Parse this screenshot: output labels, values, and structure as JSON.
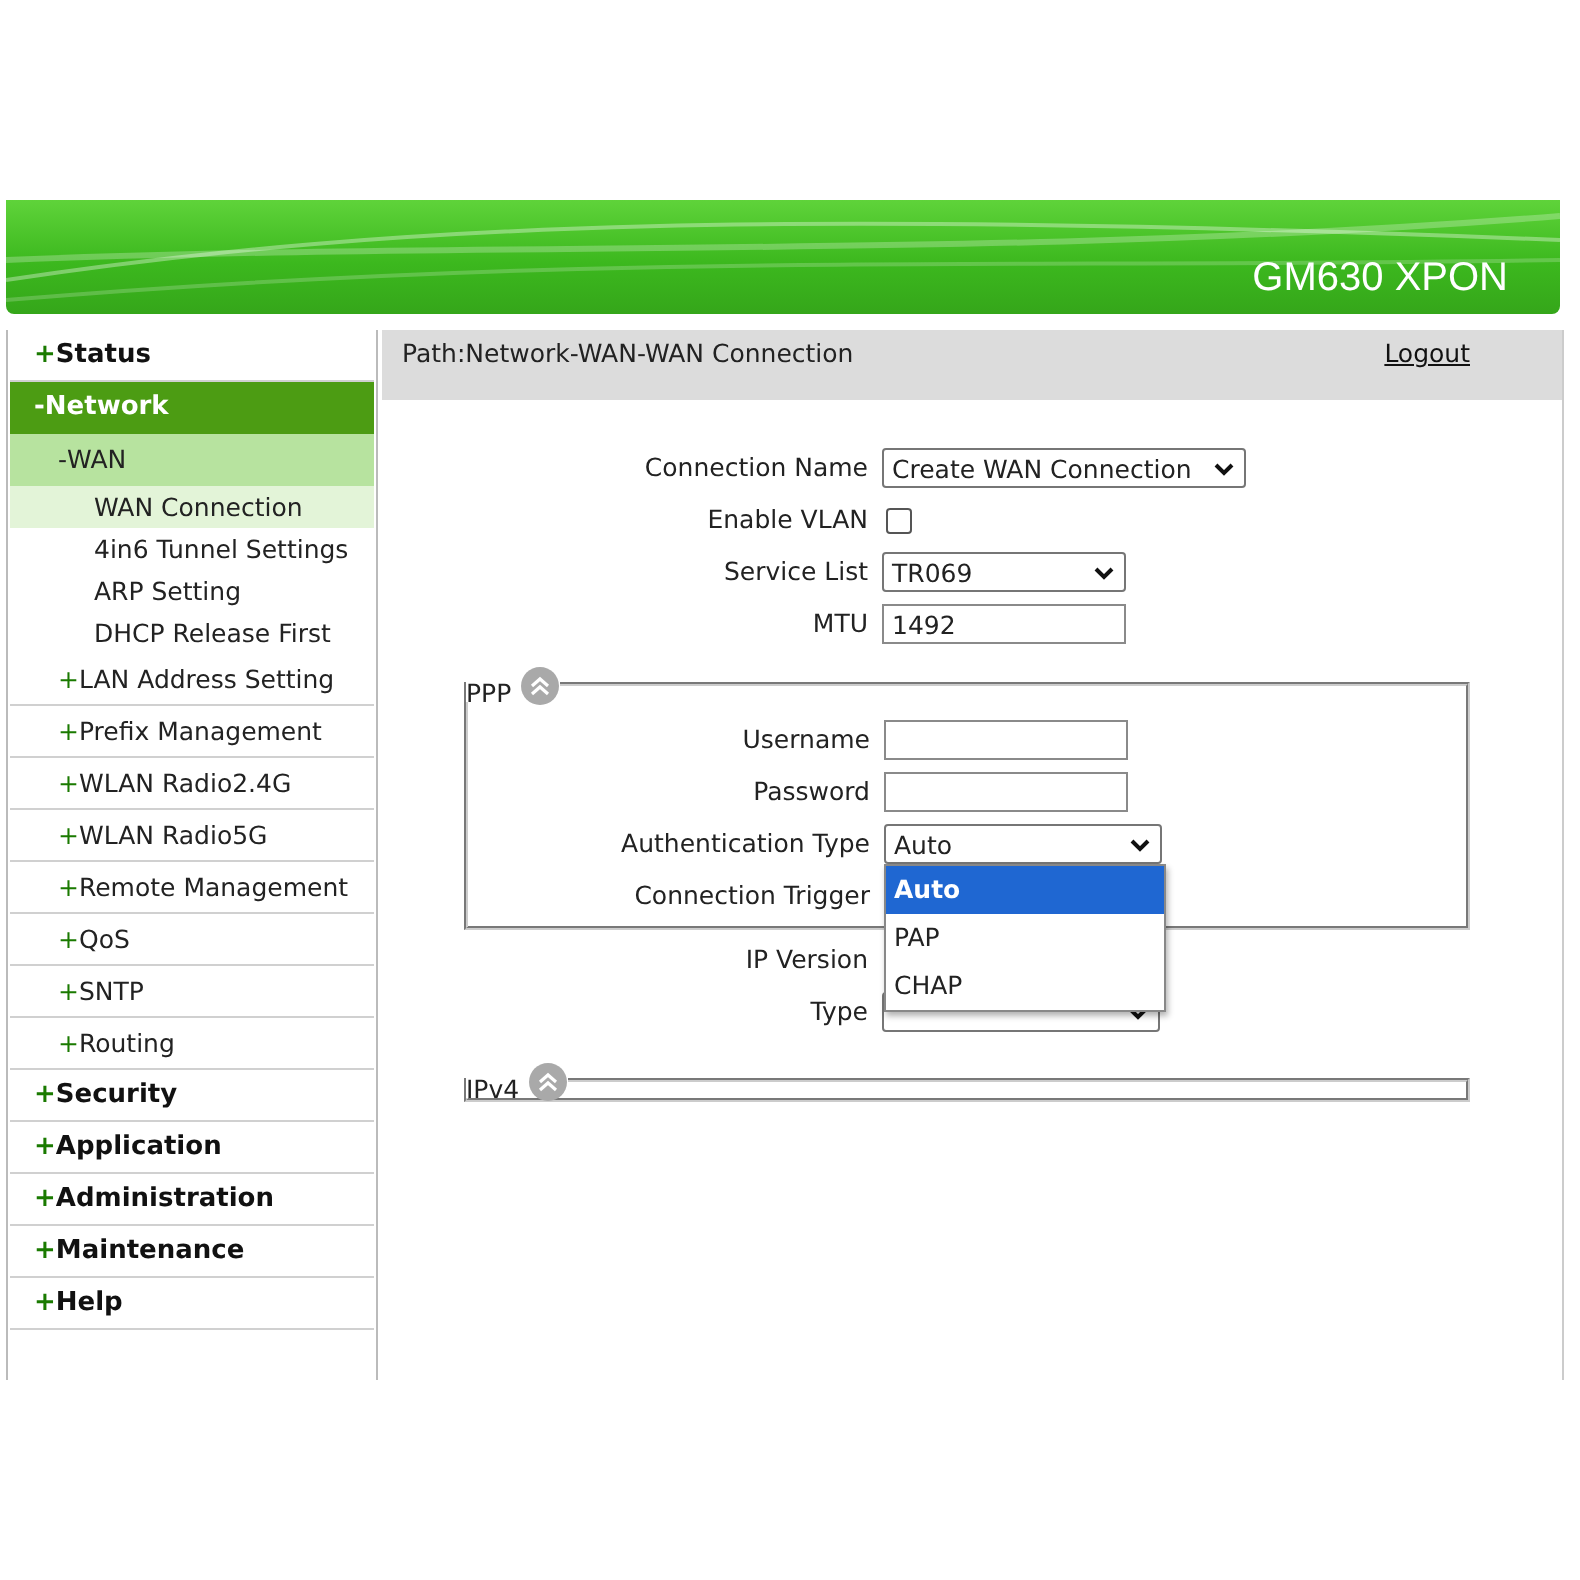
{
  "header": {
    "title": "GM630 XPON"
  },
  "sidebar": {
    "items": [
      {
        "marker": "+",
        "label": "Status",
        "selected": false
      },
      {
        "marker": "-",
        "label": "Network",
        "selected": true,
        "children": [
          {
            "marker": "-",
            "label": "WAN",
            "selected": true,
            "children": [
              {
                "label": "WAN Connection",
                "selected": true
              },
              {
                "label": "4in6 Tunnel Settings",
                "selected": false
              },
              {
                "label": "ARP Setting",
                "selected": false
              },
              {
                "label": "DHCP Release First",
                "selected": false
              }
            ]
          },
          {
            "marker": "+",
            "label": "LAN Address Setting",
            "selected": false
          },
          {
            "marker": "+",
            "label": "Prefix Management",
            "selected": false
          },
          {
            "marker": "+",
            "label": "WLAN Radio2.4G",
            "selected": false
          },
          {
            "marker": "+",
            "label": "WLAN Radio5G",
            "selected": false
          },
          {
            "marker": "+",
            "label": "Remote Management",
            "selected": false
          },
          {
            "marker": "+",
            "label": "QoS",
            "selected": false
          },
          {
            "marker": "+",
            "label": "SNTP",
            "selected": false
          },
          {
            "marker": "+",
            "label": "Routing",
            "selected": false
          }
        ]
      },
      {
        "marker": "+",
        "label": "Security",
        "selected": false
      },
      {
        "marker": "+",
        "label": "Application",
        "selected": false
      },
      {
        "marker": "+",
        "label": "Administration",
        "selected": false
      },
      {
        "marker": "+",
        "label": "Maintenance",
        "selected": false
      },
      {
        "marker": "+",
        "label": "Help",
        "selected": false
      }
    ]
  },
  "path_bar": {
    "path": "Path:Network-WAN-WAN Connection",
    "logout": "Logout"
  },
  "form": {
    "fields": [
      {
        "label": "Connection Name",
        "kind": "select",
        "value": "Create WAN Connection"
      },
      {
        "label": "Enable VLAN",
        "kind": "checkbox",
        "checked": false
      },
      {
        "label": "Service List",
        "kind": "select",
        "value": "TR069"
      },
      {
        "label": "MTU",
        "kind": "text",
        "value": "1492"
      }
    ],
    "ppp": {
      "legend": "PPP",
      "fields": [
        {
          "label": "Username",
          "kind": "text"
        },
        {
          "label": "Password",
          "kind": "text"
        },
        {
          "label": "Authentication Type",
          "kind": "select",
          "value": "Auto",
          "open": true,
          "options": [
            {
              "label": "Auto",
              "selected": true
            },
            {
              "label": "PAP",
              "selected": false
            },
            {
              "label": "CHAP",
              "selected": false
            }
          ]
        },
        {
          "label": "Connection Trigger",
          "kind": "hidden"
        }
      ]
    },
    "after": [
      {
        "label": "IP Version",
        "kind": "hidden"
      },
      {
        "label": "Type",
        "kind": "select"
      }
    ],
    "ipv4": {
      "legend": "IPv4"
    }
  }
}
